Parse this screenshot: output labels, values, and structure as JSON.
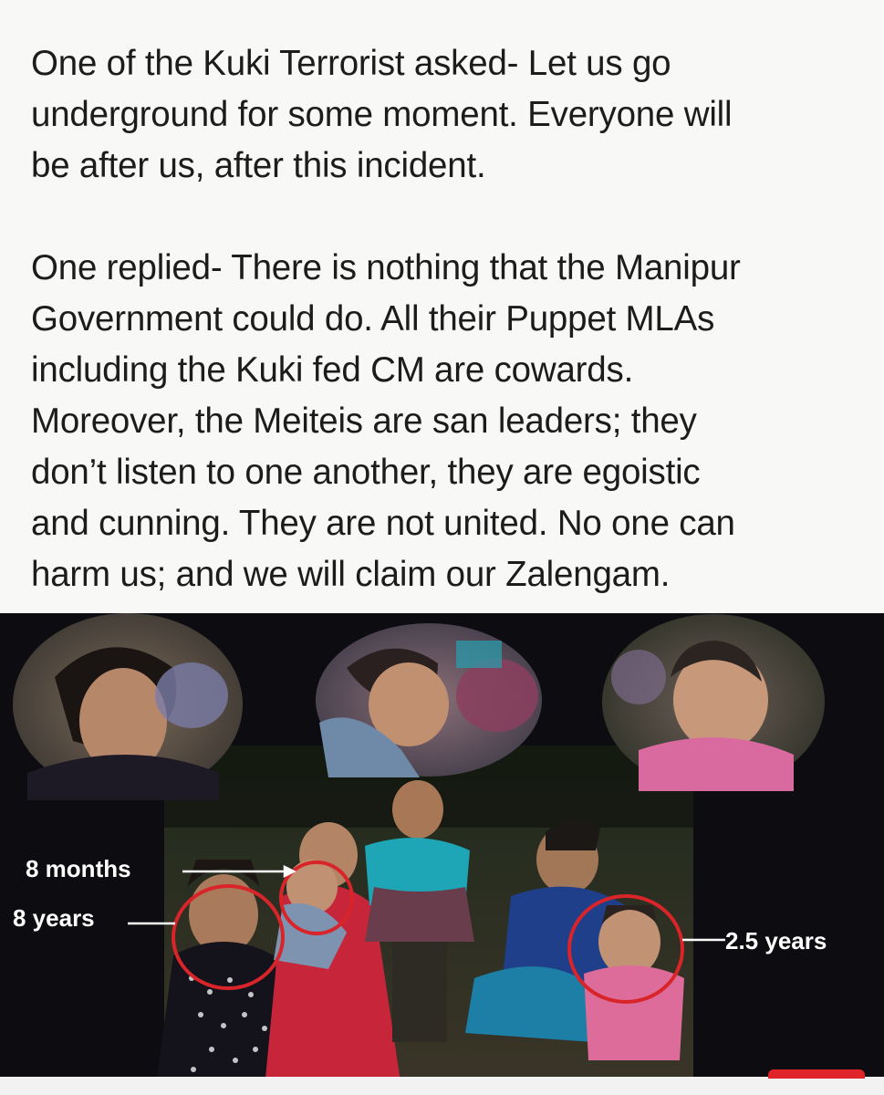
{
  "post": {
    "paragraph_1": "One of the Kuki Terrorist asked- Let us go\nunderground for some moment. Everyone will\nbe after us, after this incident.",
    "paragraph_2": "One replied- There is nothing that the Manipur\nGovernment could do. All their Puppet MLAs\nincluding the Kuki fed CM are cowards.\nMoreover, the Meiteis are san leaders; they\ndon’t listen to one another, they are egoistic\nand cunning. They are not united. No one can\nharm us; and we will claim our Zalengam."
  },
  "photo": {
    "labels": {
      "infant": "8 months",
      "girl": "8 years",
      "toddler": "2.5 years"
    }
  },
  "colors": {
    "page_background": "#f8f8f6",
    "text": "#1c1c1c",
    "photo_background": "#0d0c10",
    "highlight_circle": "#d9242a",
    "label_text": "#ffffff"
  }
}
